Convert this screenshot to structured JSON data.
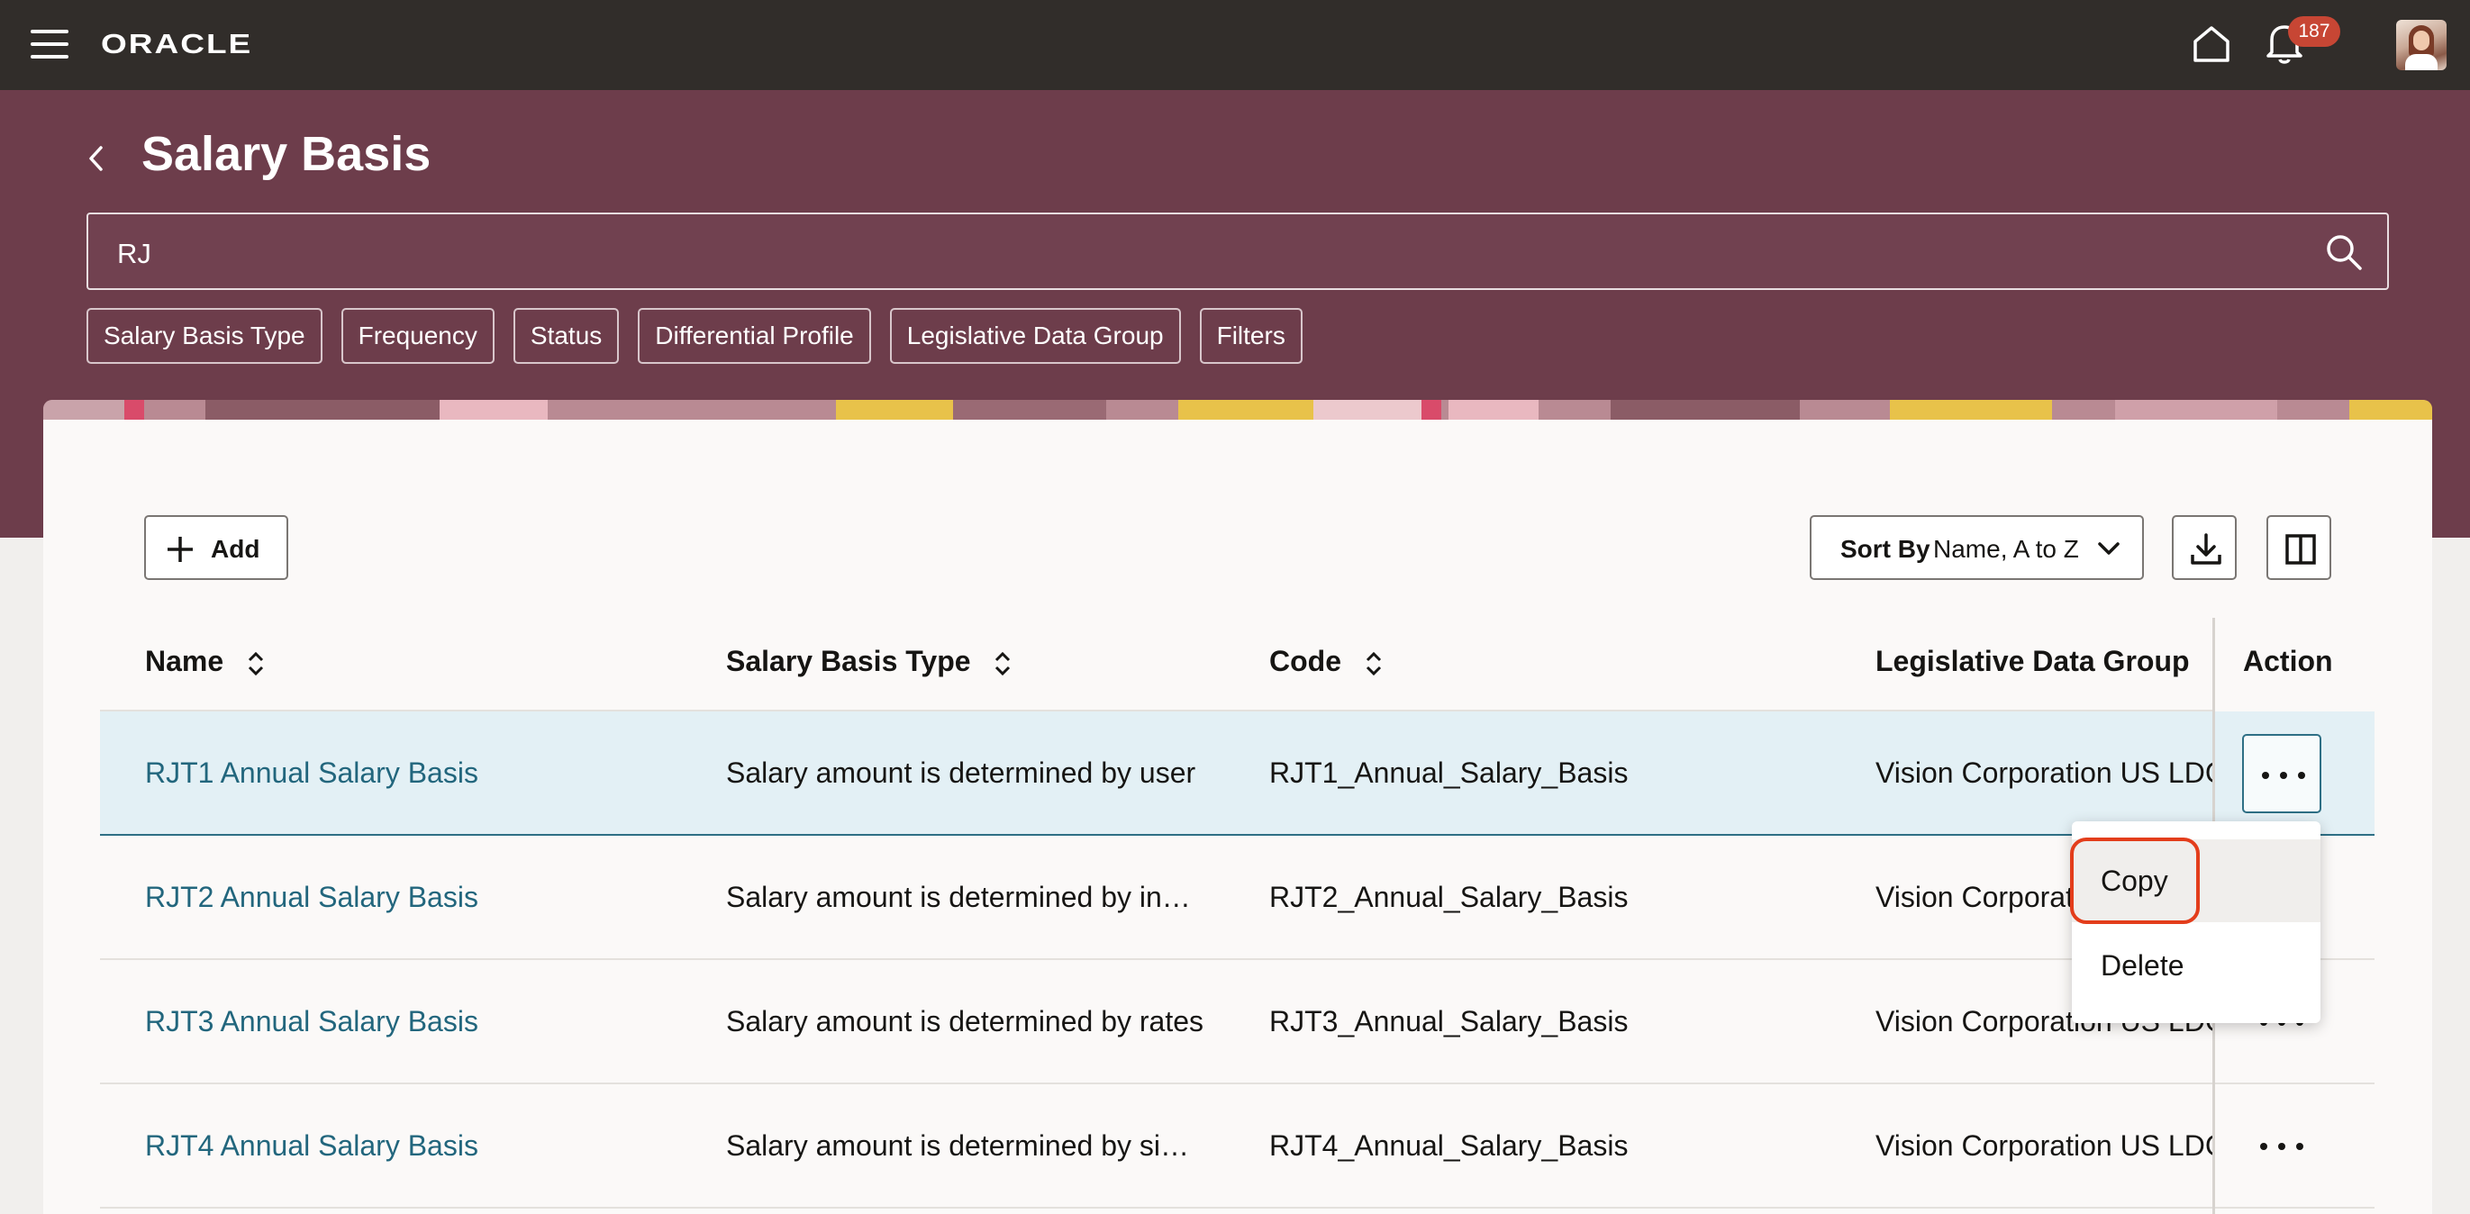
{
  "header": {
    "logo_text": "ORACLE",
    "notification_count": "187"
  },
  "page": {
    "title": "Salary Basis"
  },
  "search": {
    "value": "RJ"
  },
  "filter_chips": [
    "Salary Basis Type",
    "Frequency",
    "Status",
    "Differential Profile",
    "Legislative Data Group",
    "Filters"
  ],
  "toolbar": {
    "add_label": "Add",
    "sort_label": "Sort By",
    "sort_value": "Name, A to Z"
  },
  "table": {
    "columns": [
      "Name",
      "Salary Basis Type",
      "Code",
      "Legislative Data Group",
      "Action"
    ],
    "rows": [
      {
        "name": "RJT1 Annual Salary Basis",
        "type": "Salary amount is determined by user",
        "code": "RJT1_Annual_Salary_Basis",
        "ldg": "Vision Corporation US LDG"
      },
      {
        "name": "RJT2 Annual Salary Basis",
        "type": "Salary amount is determined by in…",
        "code": "RJT2_Annual_Salary_Basis",
        "ldg": "Vision Corporation US LDG"
      },
      {
        "name": "RJT3 Annual Salary Basis",
        "type": "Salary amount is determined by rates",
        "code": "RJT3_Annual_Salary_Basis",
        "ldg": "Vision Corporation US LDG"
      },
      {
        "name": "RJT4 Annual Salary Basis",
        "type": "Salary amount is determined by si…",
        "code": "RJT4_Annual_Salary_Basis",
        "ldg": "Vision Corporation US LDG"
      }
    ]
  },
  "action_menu": {
    "items": [
      "Copy",
      "Delete"
    ]
  },
  "colors": {
    "topbar": "#312d2a",
    "header_band": "#6d3d4b",
    "link": "#22667d",
    "selected_row": "#e3f0f5",
    "badge": "#c74634",
    "highlight_ring": "#e33d1b"
  },
  "icons": [
    "hamburger-icon",
    "home-icon",
    "bell-icon",
    "back-icon",
    "search-icon",
    "plus-icon",
    "chevron-down-icon",
    "download-icon",
    "columns-icon",
    "sort-icon",
    "more-actions-icon"
  ]
}
